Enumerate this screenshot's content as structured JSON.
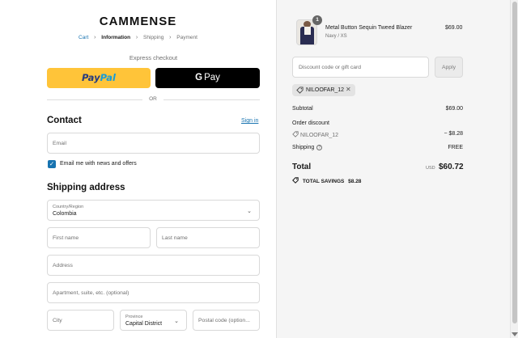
{
  "brand": {
    "logo": "CAMMENSE"
  },
  "breadcrumb": {
    "items": [
      "Cart",
      "Information",
      "Shipping",
      "Payment"
    ],
    "separator": "›"
  },
  "express": {
    "heading": "Express checkout",
    "paypal_a": "Pay",
    "paypal_b": "Pal",
    "gpay_g": "G",
    "gpay_label": "Pay",
    "or_label": "OR"
  },
  "contact": {
    "heading": "Contact",
    "signin": "Sign in",
    "email_placeholder": "Email",
    "newsletter_checked": true,
    "newsletter_label": "Email me with news and offers"
  },
  "shipping": {
    "heading": "Shipping address",
    "country_label": "Country/Region",
    "country_value": "Colombia",
    "first_name_placeholder": "First name",
    "last_name_placeholder": "Last name",
    "address_placeholder": "Address",
    "apartment_placeholder": "Apartment, suite, etc. (optional)",
    "city_placeholder": "City",
    "province_label": "Province",
    "province_value": "Capital District",
    "postal_placeholder": "Postal code (option..."
  },
  "order": {
    "item_qty": "1",
    "item_name": "Metal Button Sequin Tweed Blazer",
    "item_variant": "Navy / XS",
    "item_price": "$69.00",
    "discount_placeholder": "Discount code or gift card",
    "apply_label": "Apply",
    "applied_code": "NILOOFAR_12",
    "subtotal_label": "Subtotal",
    "subtotal_value": "$69.00",
    "order_discount_label": "Order discount",
    "discount_code_label": "NILOOFAR_12",
    "discount_value": "− $8.28",
    "shipping_label": "Shipping",
    "shipping_value": "FREE",
    "total_label": "Total",
    "total_currency": "USD",
    "total_value": "$60.72",
    "savings_label": "TOTAL SAVINGS",
    "savings_value": "$8.28"
  },
  "colors": {
    "link": "#1773b0",
    "paypal": "#ffc439",
    "sidebar_bg": "#f5f5f5"
  }
}
